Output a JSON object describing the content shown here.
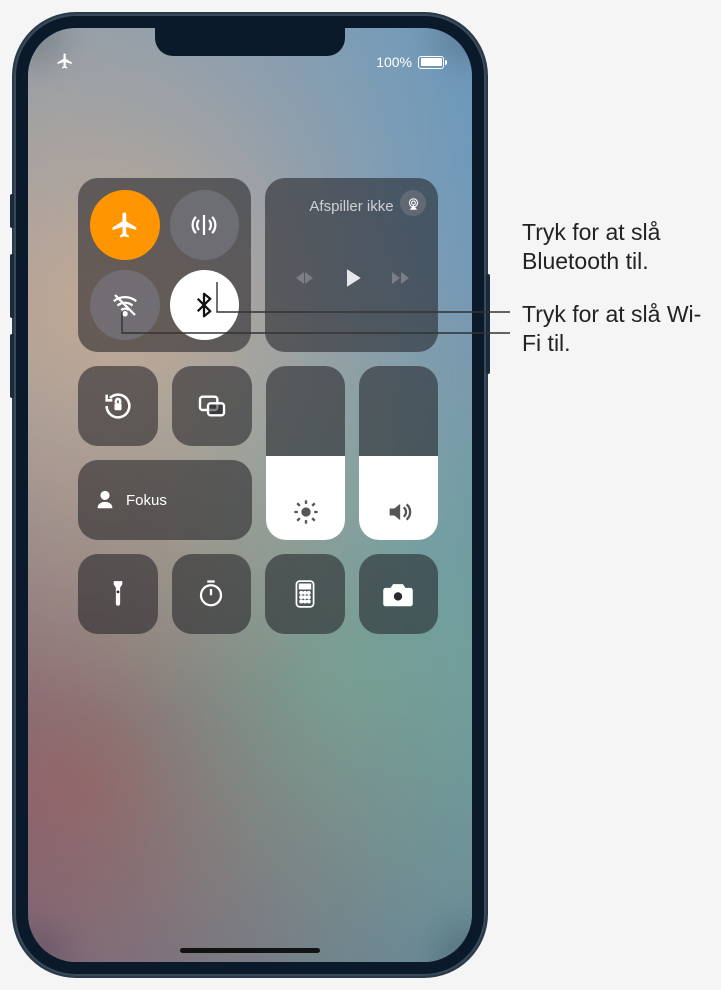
{
  "status_bar": {
    "battery_text": "100%"
  },
  "connectivity": {
    "airplane_on": true,
    "cellular_on": false,
    "wifi_on": false,
    "bluetooth_on": true
  },
  "media": {
    "now_playing_label": "Afspiller ikke"
  },
  "focus": {
    "label": "Fokus"
  },
  "sliders": {
    "brightness_percent": 48,
    "volume_percent": 48
  },
  "callouts": {
    "bluetooth": "Tryk for at slå Bluetooth til.",
    "wifi": "Tryk for at slå Wi-Fi til."
  }
}
